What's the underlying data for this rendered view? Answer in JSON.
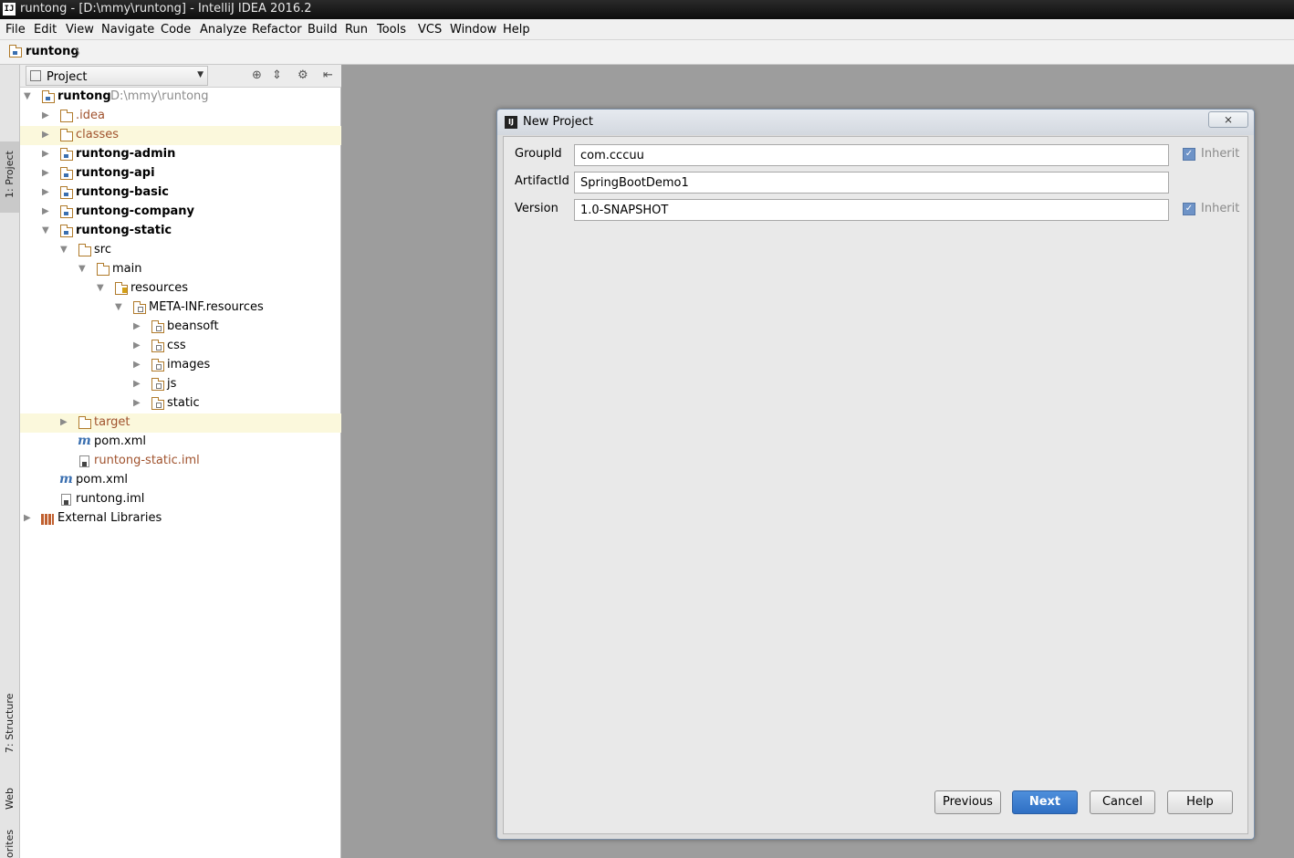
{
  "window": {
    "title": "runtong - [D:\\mmy\\runtong] - IntelliJ IDEA 2016.2",
    "logo": "IJ"
  },
  "menu": [
    "File",
    "Edit",
    "View",
    "Navigate",
    "Code",
    "Analyze",
    "Refactor",
    "Build",
    "Run",
    "Tools",
    "VCS",
    "Window",
    "Help"
  ],
  "breadcrumb": {
    "project": "runtong",
    "separator": "〉"
  },
  "tool_stripe": {
    "project_tab": "1: Project",
    "structure_tab": "7: Structure",
    "web_tab": "Web",
    "favorites_tab": "orites"
  },
  "project_panel": {
    "view_selector": "Project",
    "tree": [
      {
        "label": "runtong",
        "path": "D:\\mmy\\runtong",
        "icon": "module-folder-icon",
        "expanded": true
      },
      {
        "label": ".idea",
        "icon": "folder-icon",
        "color": "#a0522d"
      },
      {
        "label": "classes",
        "icon": "folder-icon",
        "color": "#a0522d",
        "highlighted": true
      },
      {
        "label": "runtong-admin",
        "icon": "module-folder-icon",
        "bold": true
      },
      {
        "label": "runtong-api",
        "icon": "module-folder-icon",
        "bold": true
      },
      {
        "label": "runtong-basic",
        "icon": "module-folder-icon",
        "bold": true
      },
      {
        "label": "runtong-company",
        "icon": "module-folder-icon",
        "bold": true
      },
      {
        "label": "runtong-static",
        "icon": "module-folder-icon",
        "bold": true,
        "expanded": true
      },
      {
        "label": "src",
        "icon": "folder-icon",
        "expanded": true
      },
      {
        "label": "main",
        "icon": "folder-icon",
        "expanded": true
      },
      {
        "label": "resources",
        "icon": "resources-folder-icon",
        "expanded": true
      },
      {
        "label": "META-INF.resources",
        "icon": "package-folder-icon",
        "expanded": true
      },
      {
        "label": "beansoft",
        "icon": "package-folder-icon"
      },
      {
        "label": "css",
        "icon": "package-folder-icon"
      },
      {
        "label": "images",
        "icon": "package-folder-icon"
      },
      {
        "label": "js",
        "icon": "package-folder-icon"
      },
      {
        "label": "static",
        "icon": "package-folder-icon"
      },
      {
        "label": "target",
        "icon": "folder-icon",
        "color": "#a0522d",
        "highlighted": true
      },
      {
        "label": "pom.xml",
        "icon": "maven-icon"
      },
      {
        "label": "runtong-static.iml",
        "icon": "iml-file-icon",
        "color": "#a0522d"
      },
      {
        "label": "pom.xml",
        "icon": "maven-icon"
      },
      {
        "label": "runtong.iml",
        "icon": "iml-file-icon"
      },
      {
        "label": "External Libraries",
        "icon": "library-icon"
      }
    ]
  },
  "dialog": {
    "title": "New Project",
    "close_label": "⨯",
    "fields": {
      "group_label": "GroupId",
      "group_value": "com.cccuu",
      "artifact_label": "ArtifactId",
      "artifact_value": "SpringBootDemo1",
      "version_label": "Version",
      "version_value": "1.0-SNAPSHOT",
      "inherit_label": "Inherit",
      "group_inherit_checked": true,
      "version_inherit_checked": true
    },
    "buttons": {
      "previous": "Previous",
      "next": "Next",
      "cancel": "Cancel",
      "help": "Help"
    }
  }
}
